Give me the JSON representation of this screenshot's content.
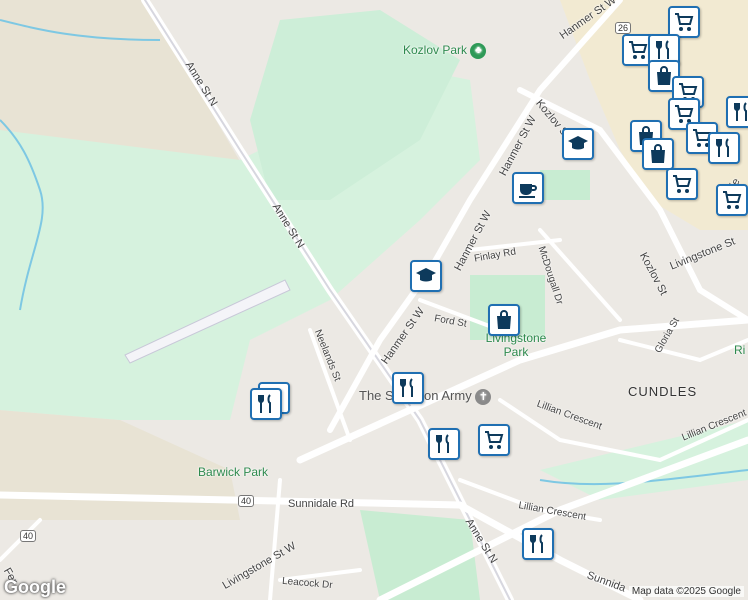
{
  "streets": {
    "anne_north_1": "Anne St N",
    "anne_north_2": "Anne St N",
    "anne_north_3": "Anne St N",
    "hanmer_w_top": "Hanmer St W",
    "hanmer_w_1": "Hanmer St W",
    "hanmer_w_2": "Hanmer St W",
    "hanmer_w_3": "Hanmer St W",
    "kozlov_1": "Kozlov S",
    "kozlov_2": "Kozlov St",
    "livingstone_e": "Livingstone St",
    "livingstone_w": "Livingstone St W",
    "finlay": "Finlay Rd",
    "mcdougall": "McDougall Dr",
    "ford": "Ford St",
    "gloria": "Gloria St",
    "lillian_1": "Lillian Crescent",
    "lillian_2": "Lillian Crescent",
    "lillian_3": "Lillian Crescent",
    "neelands": "Neelands St",
    "sunnidale": "Sunnidale Rd",
    "sunnidale_2": "Sunnida",
    "leacock": "Leacock Dr",
    "fer": "Fer",
    "rfie": "rfie"
  },
  "places": {
    "kozlov_park": "Kozlov Park",
    "livingstone_park": "Livingstone Park",
    "salvation_army": "The Salvation Army",
    "barwick_park": "Barwick Park",
    "cundles": "CUNDLES",
    "ri": "Ri"
  },
  "shields": {
    "r26": "26",
    "r40a": "40",
    "r40b": "40"
  },
  "footer": {
    "logo": "Google",
    "attribution": "Map data ©2025 Google"
  },
  "colors": {
    "poi_border": "#1f6fb2",
    "poi_icon": "#0d3a5c",
    "park_green": "#c8ecd2",
    "light_green": "#d9f5e3",
    "road": "#ffffff",
    "commercial": "#f2ead2",
    "water": "#7ec8e3"
  }
}
